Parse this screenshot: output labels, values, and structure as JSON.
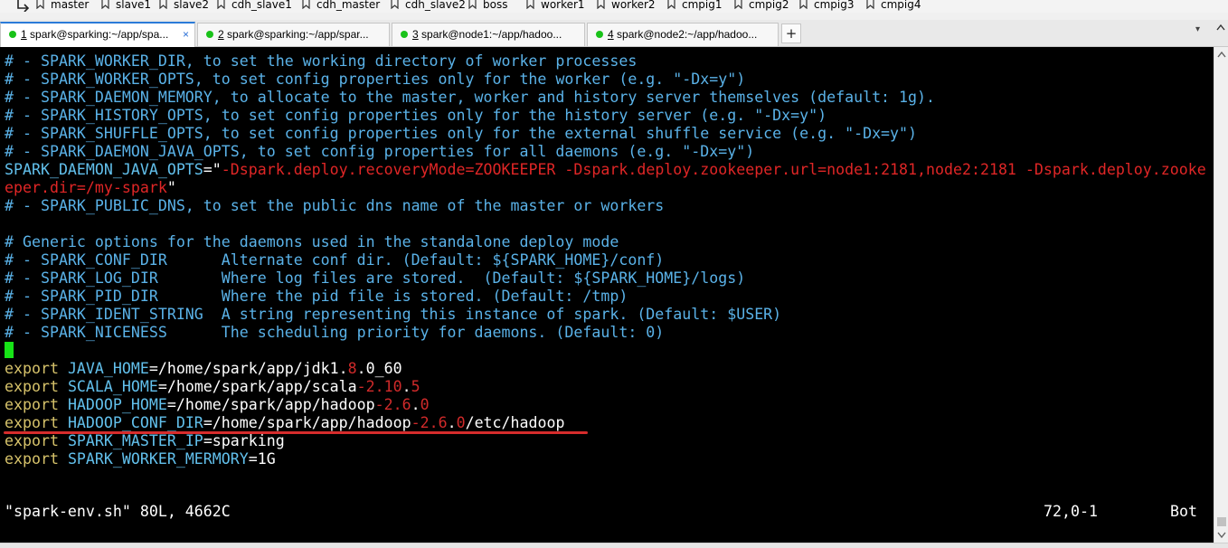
{
  "bookmarks": [
    "master",
    "slave1",
    "slave2",
    "cdh_slave1",
    "cdh_master",
    "cdh_slave2",
    "boss",
    "worker1",
    "worker2",
    "cmpig1",
    "cmpig2",
    "cmpig3",
    "cmpig4"
  ],
  "tabs": [
    {
      "num": "1",
      "label": " spark@sparking:~/app/spa...",
      "active": true,
      "close": "×"
    },
    {
      "num": "2",
      "label": " spark@sparking:~/app/spar...",
      "active": false,
      "close": ""
    },
    {
      "num": "3",
      "label": " spark@node1:~/app/hadoo...",
      "active": false,
      "close": ""
    },
    {
      "num": "4",
      "label": " spark@node2:~/app/hadoo...",
      "active": false,
      "close": ""
    }
  ],
  "add_tab_label": "+",
  "tab_menu_glyph": "▾",
  "terminal": {
    "lines": [
      [
        {
          "t": "# - SPARK_WORKER_DIR, to set the working directory of worker processes",
          "c": "comment"
        }
      ],
      [
        {
          "t": "# - SPARK_WORKER_OPTS, to set config properties only for the worker (e.g. \"-Dx=y\")",
          "c": "comment"
        }
      ],
      [
        {
          "t": "# - SPARK_DAEMON_MEMORY, to allocate to the master, worker and history server themselves (default: 1g).",
          "c": "comment"
        }
      ],
      [
        {
          "t": "# - SPARK_HISTORY_OPTS, to set config properties only for the history server (e.g. \"-Dx=y\")",
          "c": "comment"
        }
      ],
      [
        {
          "t": "# - SPARK_SHUFFLE_OPTS, to set config properties only for the external shuffle service (e.g. \"-Dx=y\")",
          "c": "comment"
        }
      ],
      [
        {
          "t": "# - SPARK_DAEMON_JAVA_OPTS, to set config properties for all daemons (e.g. \"-Dx=y\")",
          "c": "comment"
        }
      ],
      [
        {
          "t": "SPARK_DAEMON_JAVA_OPTS",
          "c": "var"
        },
        {
          "t": "=\"",
          "c": "white"
        },
        {
          "t": "-Dspark.deploy.recoveryMode=ZOOKEEPER -Dspark.deploy.zookeeper.url=node1:2181,node2:2181 -Dspark.deploy.zooke",
          "c": "str"
        }
      ],
      [
        {
          "t": "eper.dir=/my-spark",
          "c": "str"
        },
        {
          "t": "\"",
          "c": "white"
        }
      ],
      [
        {
          "t": "# - SPARK_PUBLIC_DNS, to set the public dns name of the master or workers",
          "c": "comment"
        }
      ],
      [
        {
          "t": "",
          "c": "white"
        }
      ],
      [
        {
          "t": "# Generic options for the daemons used in the standalone deploy mode",
          "c": "comment"
        }
      ],
      [
        {
          "t": "# - SPARK_CONF_DIR      Alternate conf dir. (Default: ${SPARK_HOME}/conf)",
          "c": "comment"
        }
      ],
      [
        {
          "t": "# - SPARK_LOG_DIR       Where log files are stored.  (Default: ${SPARK_HOME}/logs)",
          "c": "comment"
        }
      ],
      [
        {
          "t": "# - SPARK_PID_DIR       Where the pid file is stored. (Default: /tmp)",
          "c": "comment"
        }
      ],
      [
        {
          "t": "# - SPARK_IDENT_STRING  A string representing this instance of spark. (Default: $USER)",
          "c": "comment"
        }
      ],
      [
        {
          "t": "# - SPARK_NICENESS      The scheduling priority for daemons. (Default: 0)",
          "c": "comment"
        }
      ],
      [
        {
          "t": "",
          "c": "white"
        }
      ],
      [
        {
          "t": "export",
          "c": "kw"
        },
        {
          "t": " JAVA_HOME",
          "c": "var"
        },
        {
          "t": "=/home/spark/app/jdk1.",
          "c": "white"
        },
        {
          "t": "8",
          "c": "num"
        },
        {
          "t": ".0_60",
          "c": "white"
        }
      ],
      [
        {
          "t": "export",
          "c": "kw"
        },
        {
          "t": " SCALA_HOME",
          "c": "var"
        },
        {
          "t": "=/home/spark/app/scala",
          "c": "white"
        },
        {
          "t": "-2.",
          "c": "num"
        },
        {
          "t": "10",
          "c": "num"
        },
        {
          "t": ".",
          "c": "white"
        },
        {
          "t": "5",
          "c": "num"
        }
      ],
      [
        {
          "t": "export",
          "c": "kw"
        },
        {
          "t": " HADOOP_HOME",
          "c": "var"
        },
        {
          "t": "=/home/spark/app/hadoop",
          "c": "white"
        },
        {
          "t": "-2.",
          "c": "num"
        },
        {
          "t": "6",
          "c": "num"
        },
        {
          "t": ".",
          "c": "white"
        },
        {
          "t": "0",
          "c": "num"
        }
      ],
      [
        {
          "t": "export",
          "c": "kw"
        },
        {
          "t": " HADOOP_CONF_DIR",
          "c": "var"
        },
        {
          "t": "=/home/spark/app/hadoop",
          "c": "white"
        },
        {
          "t": "-2.",
          "c": "num"
        },
        {
          "t": "6",
          "c": "num"
        },
        {
          "t": ".",
          "c": "white"
        },
        {
          "t": "0",
          "c": "num"
        },
        {
          "t": "/etc/hadoop",
          "c": "white"
        }
      ],
      [
        {
          "t": "export",
          "c": "kw"
        },
        {
          "t": " SPARK_MASTER_IP",
          "c": "var"
        },
        {
          "t": "=sparking",
          "c": "white"
        }
      ],
      [
        {
          "t": "export",
          "c": "kw"
        },
        {
          "t": " SPARK_WORKER_MERMORY",
          "c": "var"
        },
        {
          "t": "=1G",
          "c": "white"
        }
      ]
    ],
    "status_left": "\"spark-env.sh\" 80L, 4662C",
    "status_position": "72,0-1",
    "status_scroll": "Bot"
  }
}
